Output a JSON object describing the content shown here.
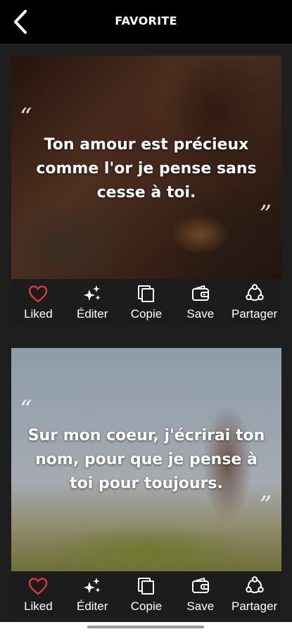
{
  "header": {
    "title": "FAVORITE"
  },
  "cards": [
    {
      "quote": "Ton amour est précieux comme l'or je pense sans cesse à toi.",
      "open_quote": "“",
      "close_quote": "”"
    },
    {
      "quote": "Sur mon coeur, j'écrirai ton nom, pour que je pense à toi pour toujours.",
      "open_quote": "“",
      "close_quote": "”"
    }
  ],
  "actions": {
    "liked": "Liked",
    "edit": "Éditer",
    "copy": "Copie",
    "save": "Save",
    "share": "Partager"
  },
  "icons": {
    "back": "back-arrow-icon",
    "liked": "heart-icon",
    "edit": "sparkle-icon",
    "copy": "copy-icon",
    "save": "wallet-icon",
    "share": "share-icon"
  },
  "colors": {
    "topbar": "#000000",
    "background": "#1e1e1e",
    "liked": "#e53935"
  }
}
